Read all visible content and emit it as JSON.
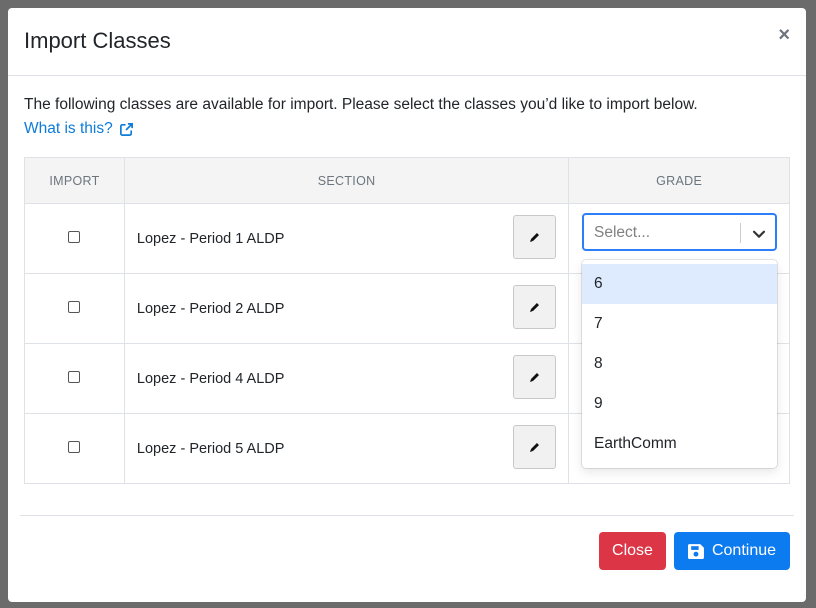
{
  "dialog": {
    "title": "Import Classes",
    "close_symbol": "×"
  },
  "intro": {
    "text": "The following classes are available for import. Please select the classes you’d like to import below.",
    "link_text": "What is this?",
    "link_icon": "external-link-icon"
  },
  "table": {
    "headers": [
      "IMPORT",
      "SECTION",
      "GRADE"
    ],
    "rows": [
      {
        "section": "Lopez - Period 1 ALDP",
        "checked": false
      },
      {
        "section": "Lopez - Period 2 ALDP",
        "checked": false
      },
      {
        "section": "Lopez - Period 4 ALDP",
        "checked": false
      },
      {
        "section": "Lopez - Period 5 ALDP",
        "checked": false
      }
    ],
    "edit_icon": "pencil-icon"
  },
  "grade_select": {
    "placeholder": "Select...",
    "options": [
      "6",
      "7",
      "8",
      "9",
      "EarthComm"
    ],
    "highlighted_option": "6"
  },
  "footer": {
    "close_label": "Close",
    "continue_label": "Continue",
    "continue_icon": "save-icon"
  },
  "colors": {
    "primary": "#0d7bf0",
    "danger": "#dc3545",
    "link": "#0d7bd8",
    "focus": "#2d7ff9",
    "option_highlight": "#deebff"
  }
}
